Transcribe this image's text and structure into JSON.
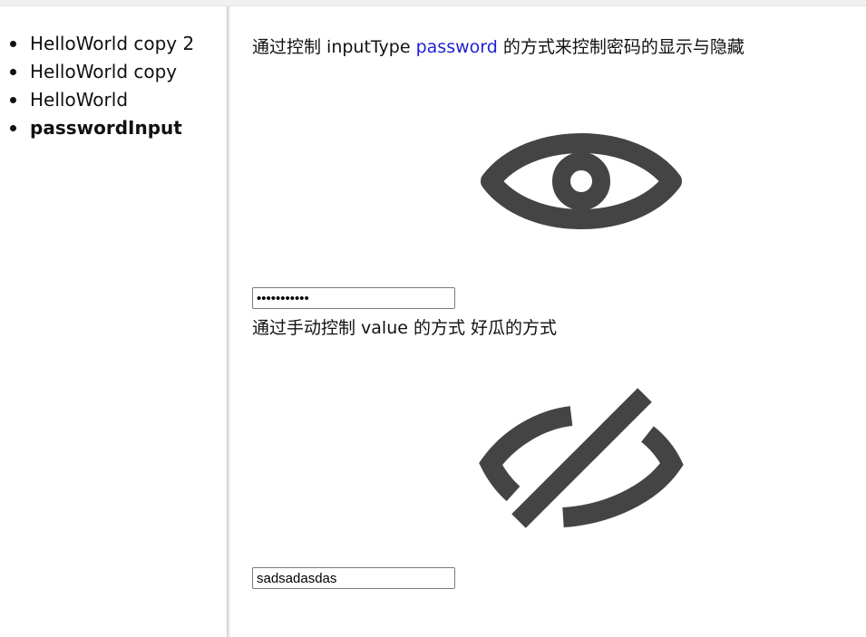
{
  "sidebar": {
    "items": [
      {
        "label": "HelloWorld copy 2",
        "active": false
      },
      {
        "label": "HelloWorld copy",
        "active": false
      },
      {
        "label": "HelloWorld",
        "active": false
      },
      {
        "label": "passwordInput",
        "active": true
      }
    ]
  },
  "main": {
    "heading": {
      "prefix": "通过控制 inputType ",
      "link_word": "password",
      "suffix": " 的方式来控制密码的显示与隐藏"
    },
    "password_field": {
      "value": "sadsadasdas",
      "type": "password"
    },
    "subheading": "通过手动控制 value 的方式 好瓜的方式",
    "text_field": {
      "value": "sadsadasdas",
      "type": "text"
    },
    "icons": {
      "first": "eye-icon",
      "second": "eye-off-icon"
    },
    "icon_color": "#444444",
    "link_color": "#1f1fd6"
  }
}
